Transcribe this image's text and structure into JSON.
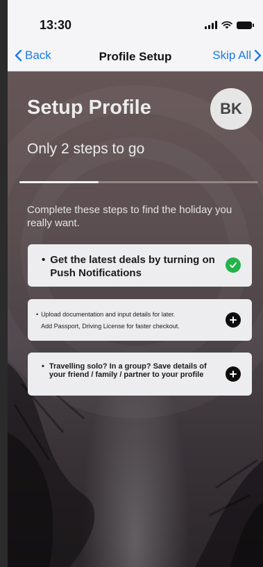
{
  "status_bar": {
    "time": "13:30"
  },
  "nav": {
    "back_label": "Back",
    "title": "Profile Setup",
    "skip_label": "Skip All"
  },
  "header": {
    "title": "Setup Profile",
    "avatar_initials": "BK",
    "subtitle": "Only 2 steps to go"
  },
  "progress": {
    "fraction_complete": 0.33
  },
  "intro_text": "Complete these steps to find the holiday you really want.",
  "steps": [
    {
      "lines": [
        "Get the latest deals by turning on Push Notifications"
      ],
      "status": "complete",
      "icon": "check-circle-icon",
      "icon_color": "#24b34a"
    },
    {
      "lines": [
        "Upload documentation and input details for later.",
        "Add Passport, Driving License for faster checkout."
      ],
      "status": "pending",
      "icon": "plus-circle-icon",
      "icon_color": "#0d0d0d"
    },
    {
      "lines": [
        "Travelling solo? In a group? Save details of your friend / family / partner to your profile"
      ],
      "status": "pending",
      "icon": "plus-circle-icon",
      "icon_color": "#0d0d0d"
    }
  ],
  "colors": {
    "accent": "#1a7ae6",
    "complete": "#24b34a"
  }
}
